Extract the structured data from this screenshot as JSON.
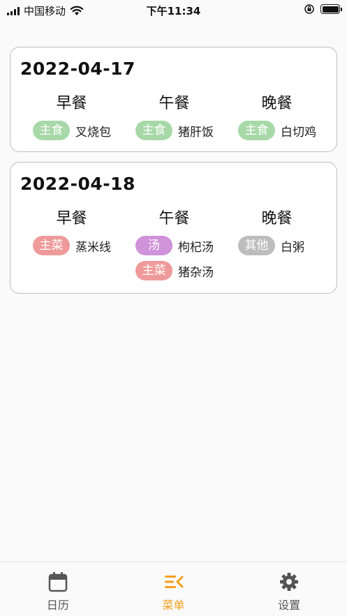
{
  "status_bar": {
    "carrier": "中国移动",
    "time": "下午11:34"
  },
  "cards": [
    {
      "date": "2022-04-17",
      "meals": [
        {
          "title": "早餐",
          "dishes": [
            {
              "tag": "主食",
              "tag_color": "#a8d8a8",
              "name": "叉烧包"
            }
          ]
        },
        {
          "title": "午餐",
          "dishes": [
            {
              "tag": "主食",
              "tag_color": "#a8d8a8",
              "name": "猪肝饭"
            }
          ]
        },
        {
          "title": "晚餐",
          "dishes": [
            {
              "tag": "主食",
              "tag_color": "#a8d8a8",
              "name": "白切鸡"
            }
          ]
        }
      ]
    },
    {
      "date": "2022-04-18",
      "meals": [
        {
          "title": "早餐",
          "dishes": [
            {
              "tag": "主菜",
              "tag_color": "#ef9a9a",
              "name": "蒸米线"
            }
          ]
        },
        {
          "title": "午餐",
          "dishes": [
            {
              "tag": "汤",
              "tag_color": "#ce93d8",
              "name": "枸杞汤"
            },
            {
              "tag": "主菜",
              "tag_color": "#ef9a9a",
              "name": "猪杂汤"
            }
          ]
        },
        {
          "title": "晚餐",
          "dishes": [
            {
              "tag": "其他",
              "tag_color": "#bdbdbd",
              "name": "白粥"
            }
          ]
        }
      ]
    }
  ],
  "tabbar": {
    "items": [
      {
        "label": "日历",
        "icon": "calendar-icon",
        "active": false
      },
      {
        "label": "菜单",
        "icon": "menu-list-icon",
        "active": true
      },
      {
        "label": "设置",
        "icon": "gear-icon",
        "active": false
      }
    ],
    "active_color": "#f3a020"
  }
}
